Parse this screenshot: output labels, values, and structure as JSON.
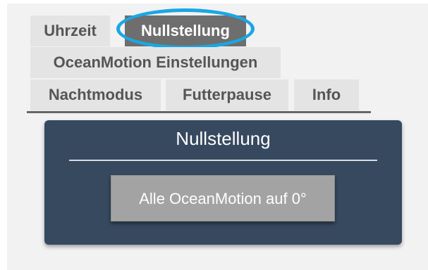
{
  "tabs": {
    "uhrzeit": "Uhrzeit",
    "nullstellung": "Nullstellung",
    "oceanmotion": "OceanMotion Einstellungen",
    "nachtmodus": "Nachtmodus",
    "futterpause": "Futterpause",
    "info": "Info"
  },
  "active_tab": "Nullstellung",
  "panel": {
    "title": "Nullstellung",
    "button_label": "Alle OceanMotion auf 0°"
  },
  "colors": {
    "panel_bg": "#36495f",
    "active_tab_bg": "#6e6e6e",
    "highlight_ring": "#19a7e4",
    "button_bg": "#a3a3a3"
  }
}
